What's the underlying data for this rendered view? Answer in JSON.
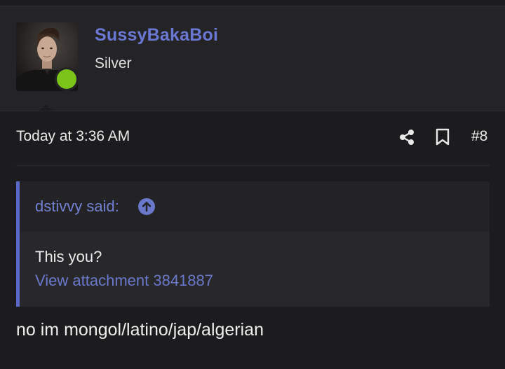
{
  "user": {
    "name": "SussyBakaBoi",
    "title": "Silver",
    "status": "online",
    "status_color": "#7cc419",
    "name_color": "#6a78d4"
  },
  "post": {
    "timestamp": "Today at 3:36 AM",
    "number": "#8",
    "actions": [
      "share-icon",
      "bookmark-icon"
    ],
    "body": "no im mongol/latino/jap/algerian"
  },
  "quote": {
    "author_label": "dstivvy said:",
    "jump_icon": "arrow-up-circle-icon",
    "text": "This you?",
    "attachment_link": "View attachment 3841887",
    "accent_color": "#5a68c6"
  }
}
